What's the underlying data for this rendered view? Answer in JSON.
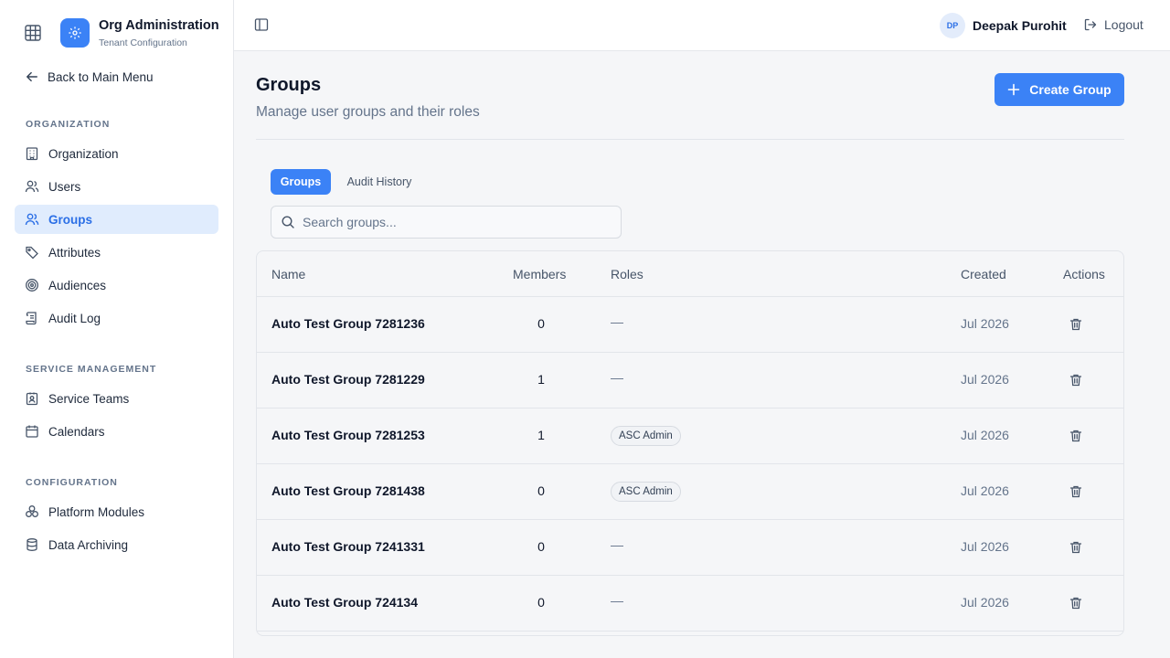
{
  "app": {
    "title": "Org Administration",
    "subtitle": "Tenant Configuration"
  },
  "sidebar": {
    "back_label": "Back to Main Menu",
    "sections": [
      {
        "label": "ORGANIZATION",
        "items": [
          {
            "label": "Organization",
            "icon": "building-icon"
          },
          {
            "label": "Users",
            "icon": "users-icon"
          },
          {
            "label": "Groups",
            "icon": "user-group-icon",
            "active": true
          },
          {
            "label": "Attributes",
            "icon": "tag-icon"
          },
          {
            "label": "Audiences",
            "icon": "target-icon"
          },
          {
            "label": "Audit Log",
            "icon": "scroll-icon"
          }
        ]
      },
      {
        "label": "SERVICE MANAGEMENT",
        "items": [
          {
            "label": "Service Teams",
            "icon": "id-badge-icon"
          },
          {
            "label": "Calendars",
            "icon": "calendar-icon"
          }
        ]
      },
      {
        "label": "CONFIGURATION",
        "items": [
          {
            "label": "Platform Modules",
            "icon": "modules-icon"
          },
          {
            "label": "Data Archiving",
            "icon": "database-icon"
          }
        ]
      }
    ]
  },
  "topbar": {
    "user_initials": "DP",
    "user_name": "Deepak Purohit",
    "logout_label": "Logout"
  },
  "page": {
    "title": "Groups",
    "subtitle": "Manage user groups and their roles",
    "create_label": "Create Group",
    "tabs": [
      {
        "label": "Groups",
        "active": true
      },
      {
        "label": "Audit History"
      }
    ],
    "search": {
      "placeholder": "Search groups...",
      "value": ""
    }
  },
  "table": {
    "columns": {
      "name": "Name",
      "members": "Members",
      "roles": "Roles",
      "created": "Created",
      "actions": "Actions"
    },
    "rows": [
      {
        "name": "Auto Test Group 7281236",
        "members": "0",
        "roles": "—",
        "created": "Jul 2026"
      },
      {
        "name": "Auto Test Group 7281229",
        "members": "1",
        "roles": "—",
        "created": "Jul 2026"
      },
      {
        "name": "Auto Test Group 7281253",
        "members": "1",
        "roles": "ASC Admin",
        "created": "Jul 2026"
      },
      {
        "name": "Auto Test Group 7281438",
        "members": "0",
        "roles": "ASC Admin",
        "created": "Jul 2026"
      },
      {
        "name": "Auto Test Group 7241331",
        "members": "0",
        "roles": "—",
        "created": "Jul 2026"
      },
      {
        "name": "Auto Test Group 724134",
        "members": "0",
        "roles": "—",
        "created": "Jul 2026"
      }
    ]
  },
  "colors": {
    "accent": "#3b82f6",
    "active_bg": "#e0ecfd",
    "active_text": "#2b6fe6"
  }
}
